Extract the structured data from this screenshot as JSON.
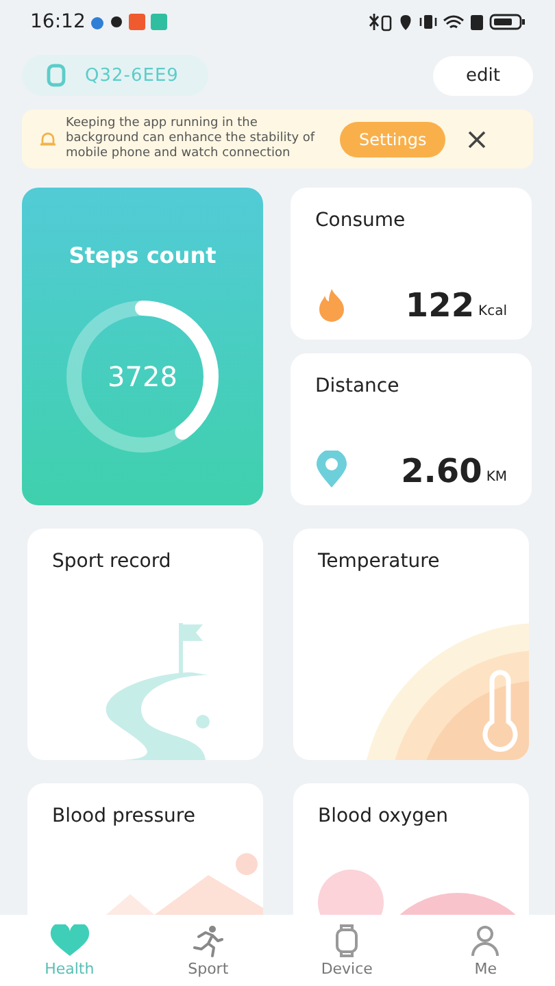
{
  "status_bar": {
    "time": "16:12"
  },
  "device": {
    "name": "Q32-6EE9"
  },
  "edit_button": {
    "label": "edit"
  },
  "banner": {
    "text": "Keeping the app running in the background can enhance the stability of mobile phone and watch connection",
    "button": "Settings"
  },
  "steps": {
    "title": "Steps count",
    "value": "3728",
    "level": 0.4
  },
  "consume": {
    "title": "Consume",
    "value": "122",
    "unit": "Kcal"
  },
  "distance": {
    "title": "Distance",
    "value": "2.60",
    "unit": "KM"
  },
  "cards": [
    {
      "kind": "sport",
      "title": "Sport record"
    },
    {
      "kind": "temperature",
      "title": "Temperature"
    },
    {
      "kind": "pressure",
      "title": "Blood pressure"
    },
    {
      "kind": "oxygen",
      "title": "Blood oxygen"
    }
  ],
  "tabs": [
    {
      "kind": "health",
      "label": "Health",
      "selected": true
    },
    {
      "kind": "sport",
      "label": "Sport",
      "selected": false
    },
    {
      "kind": "device",
      "label": "Device",
      "selected": false
    },
    {
      "kind": "me",
      "label": "Me",
      "selected": false
    }
  ]
}
